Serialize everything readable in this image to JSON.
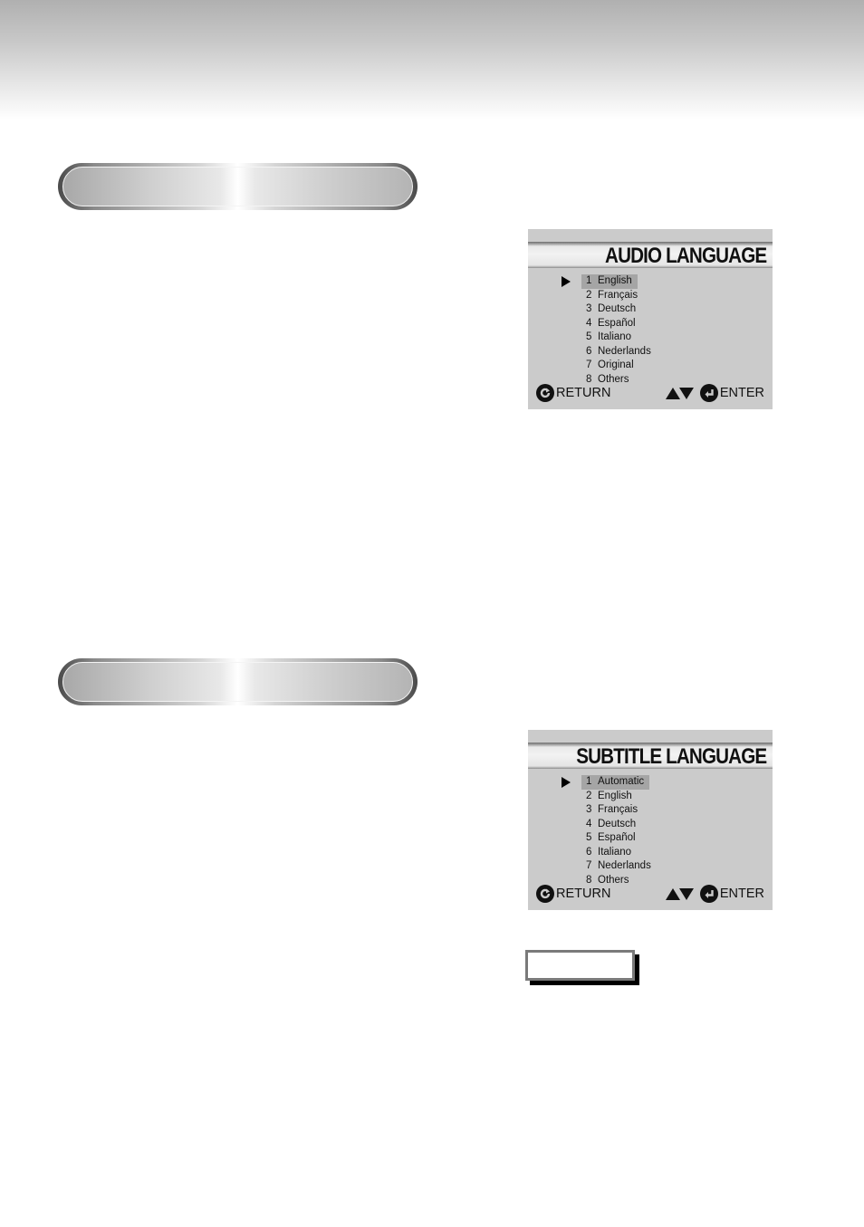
{
  "audio_menu": {
    "title": "AUDIO LANGUAGE",
    "selected_index": 0,
    "items": [
      {
        "num": "1",
        "label": "English"
      },
      {
        "num": "2",
        "label": "Français"
      },
      {
        "num": "3",
        "label": "Deutsch"
      },
      {
        "num": "4",
        "label": "Español"
      },
      {
        "num": "5",
        "label": "Italiano"
      },
      {
        "num": "6",
        "label": "Nederlands"
      },
      {
        "num": "7",
        "label": "Original"
      },
      {
        "num": "8",
        "label": "Others"
      }
    ],
    "return_label": "RETURN",
    "enter_label": "ENTER"
  },
  "subtitle_menu": {
    "title": "SUBTITLE LANGUAGE",
    "selected_index": 0,
    "items": [
      {
        "num": "1",
        "label": "Automatic"
      },
      {
        "num": "2",
        "label": "English"
      },
      {
        "num": "3",
        "label": "Français"
      },
      {
        "num": "4",
        "label": "Deutsch"
      },
      {
        "num": "5",
        "label": "Español"
      },
      {
        "num": "6",
        "label": "Italiano"
      },
      {
        "num": "7",
        "label": "Nederlands"
      },
      {
        "num": "8",
        "label": "Others"
      }
    ],
    "return_label": "RETURN",
    "enter_label": "ENTER"
  },
  "icons": {
    "selection_arrow": "selection-arrow-icon",
    "return": "return-icon",
    "navigate": "up-down-arrows-icon",
    "enter": "enter-icon"
  },
  "colors": {
    "osd_background": "#cbcbcb",
    "highlight": "#a5a5a5",
    "text": "#111111"
  }
}
